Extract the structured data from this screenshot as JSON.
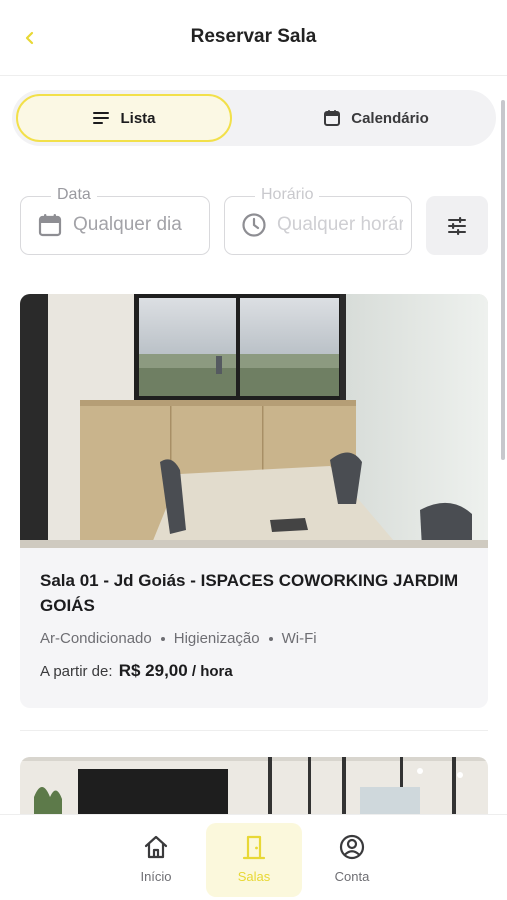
{
  "header": {
    "title": "Reservar Sala",
    "back_icon": "chevron-left-icon"
  },
  "view_toggle": {
    "options": [
      {
        "label": "Lista",
        "icon": "list-icon",
        "selected": true
      },
      {
        "label": "Calendário",
        "icon": "calendar-icon",
        "selected": false
      }
    ]
  },
  "filters": {
    "date": {
      "label": "Data",
      "placeholder": "Qualquer dia",
      "icon": "calendar-icon"
    },
    "time": {
      "label": "Horário",
      "placeholder": "Qualquer horário",
      "icon": "clock-icon"
    },
    "filter_button_icon": "sliders-icon"
  },
  "rooms": [
    {
      "name": "Sala 01 - Jd Goiás - ISPACES COWORKING JARDIM GOIÁS",
      "amenities": [
        "Ar-Condicionado",
        "Higienização",
        "Wi-Fi"
      ],
      "price_prefix": "A partir de:",
      "price": "R$ 29,00",
      "price_unit": "/ hora"
    }
  ],
  "bottom_nav": {
    "items": [
      {
        "label": "Início",
        "icon": "home-icon",
        "active": false
      },
      {
        "label": "Salas",
        "icon": "door-icon",
        "active": true
      },
      {
        "label": "Conta",
        "icon": "user-circle-icon",
        "active": false
      }
    ]
  },
  "colors": {
    "accent": "#f2e04a",
    "accent_text": "#e8d835",
    "accent_bg": "#fbf8e4"
  }
}
